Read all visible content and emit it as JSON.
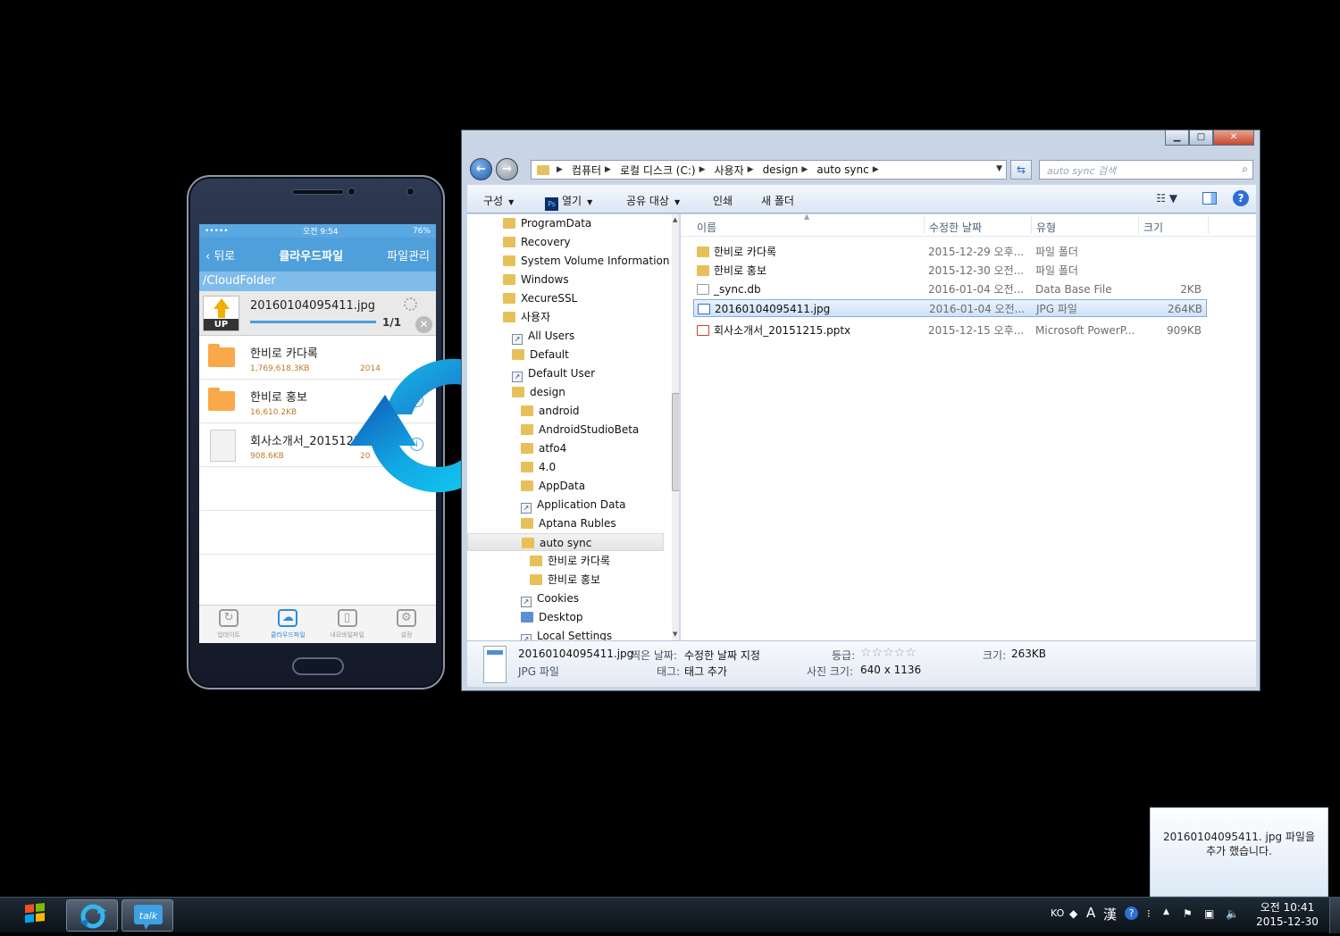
{
  "phone": {
    "status": {
      "time": "오전 9:54",
      "battery": "76%"
    },
    "nav": {
      "back_label": "뒤로",
      "title": "클라우드파일",
      "manage_label": "파일관리"
    },
    "path": "/CloudFolder",
    "upload": {
      "badge": "UP",
      "filename": "20160104095411.jpg",
      "count": "1/1",
      "progress": 1.0
    },
    "files": [
      {
        "name": "한비로 카다록",
        "size": "1,769,618.3KB",
        "date": "2014",
        "type": "folder"
      },
      {
        "name": "한비로 홍보",
        "size": "16,610.2KB",
        "date": "",
        "type": "folder"
      },
      {
        "name": "회사소개서_20151215.",
        "size": "908.6KB",
        "date": "20",
        "type": "file"
      }
    ],
    "tabs": [
      {
        "label": "업데이트",
        "icon": "refresh-icon"
      },
      {
        "label": "클라우드파일",
        "icon": "cloud-monitor-icon"
      },
      {
        "label": "내모바일파일",
        "icon": "mobile-icon"
      },
      {
        "label": "설정",
        "icon": "gear-icon"
      }
    ]
  },
  "explorer": {
    "address": [
      "컴퓨터",
      "로컬 디스크 (C:)",
      "사용자",
      "design",
      "auto sync"
    ],
    "search_placeholder": "auto sync 검색",
    "toolbar": {
      "organize": "구성",
      "open": "열기",
      "share": "공유 대상",
      "print": "인쇄",
      "new_folder": "새 폴더"
    },
    "tree": [
      "ProgramData",
      "Recovery",
      "System Volume Information",
      "Windows",
      "XecureSSL",
      "사용자",
      "All Users",
      "Default",
      "Default User",
      "design",
      "android",
      "AndroidStudioBeta",
      "atfo4",
      "4.0",
      "AppData",
      "Application Data",
      "Aptana Rubles",
      "auto sync",
      "한비로 카다록",
      "한비로 홍보",
      "Cookies",
      "Desktop",
      "Local Settings"
    ],
    "columns": {
      "name": "이름",
      "modified": "수정한 날짜",
      "type": "유형",
      "size": "크기"
    },
    "rows": [
      {
        "name": "한비로 카다록",
        "modified": "2015-12-29 오후...",
        "type": "파일 폴더",
        "size": "",
        "icon": "folder"
      },
      {
        "name": "한비로 홍보",
        "modified": "2015-12-30 오전...",
        "type": "파일 폴더",
        "size": "",
        "icon": "folder"
      },
      {
        "name": "_sync.db",
        "modified": "2016-01-04 오전...",
        "type": "Data Base File",
        "size": "2KB",
        "icon": "db"
      },
      {
        "name": "20160104095411.jpg",
        "modified": "2016-01-04 오전...",
        "type": "JPG 파일",
        "size": "264KB",
        "icon": "jpg"
      },
      {
        "name": "회사소개서_20151215.pptx",
        "modified": "2015-12-15 오후...",
        "type": "Microsoft PowerP...",
        "size": "909KB",
        "icon": "ppt"
      }
    ],
    "details": {
      "filename": "20160104095411.jpg",
      "filetype": "JPG 파일",
      "taken_label": "찍은 날짜:",
      "taken_value": "수정한 날짜 지정",
      "tags_label": "태그:",
      "tags_value": "태그 추가",
      "rating_label": "등급:",
      "rating_stars": "☆☆☆☆☆",
      "dimensions_label": "사진 크기:",
      "dimensions_value": "640 x 1136",
      "size_label": "크기:",
      "size_value": "263KB"
    }
  },
  "notification": {
    "line1": "20160104095411. jpg 파일을",
    "line2": "추가 했습니다."
  },
  "taskbar": {
    "lang": "KO",
    "ime_a": "A",
    "ime_hanja": "漢",
    "clock_time": "오전 10:41",
    "clock_date": "2015-12-30"
  }
}
